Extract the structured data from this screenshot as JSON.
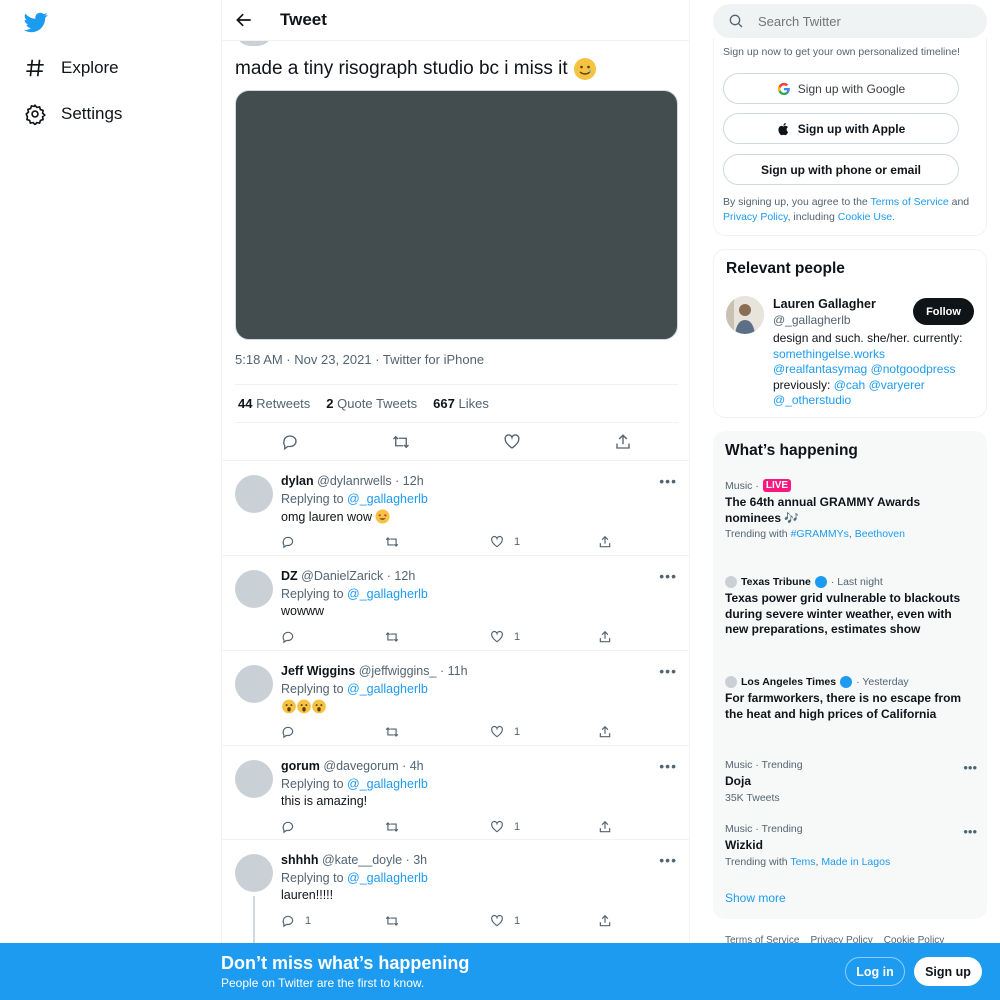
{
  "nav": {
    "items": [
      {
        "label": "Explore",
        "icon": "hashtag-icon"
      },
      {
        "label": "Settings",
        "icon": "gear-icon"
      }
    ]
  },
  "header": {
    "title": "Tweet"
  },
  "tweet": {
    "text": "made a tiny risograph studio bc i miss it",
    "emoji": "smiling-tear-emoji",
    "meta": "5:18 AM · Nov 23, 2021 · Twitter for iPhone",
    "retweets": {
      "count": "44",
      "label": "Retweets"
    },
    "quotes": {
      "count": "2",
      "label": "Quote Tweets"
    },
    "likes": {
      "count": "667",
      "label": "Likes"
    }
  },
  "replies": [
    {
      "name": "dylan",
      "handle": "@dylanrwells",
      "time": "· 12h",
      "replying": "Replying to",
      "to": "@_gallagherlb",
      "text": "omg lauren wow",
      "emoji": "heart-eyes-emoji",
      "reply_count": "",
      "like_count": "1"
    },
    {
      "name": "DZ",
      "handle": "@DanielZarick",
      "time": "· 12h",
      "replying": "Replying to",
      "to": "@_gallagherlb",
      "text": "wowww",
      "reply_count": "",
      "like_count": "1"
    },
    {
      "name": "Jeff Wiggins",
      "handle": "@jeffwiggins_",
      "time": "· 11h",
      "replying": "Replying to",
      "to": "@_gallagherlb",
      "text": "",
      "emoji": "astonished-face-emoji-x3",
      "reply_count": "",
      "like_count": "1"
    },
    {
      "name": "gorum",
      "handle": "@davegorum",
      "time": "· 4h",
      "replying": "Replying to",
      "to": "@_gallagherlb",
      "text": "this is amazing!",
      "reply_count": "",
      "like_count": "1"
    },
    {
      "name": "shhhh",
      "handle": "@kate__doyle",
      "time": "· 3h",
      "replying": "Replying to",
      "to": "@_gallagherlb",
      "text": "lauren!!!!!",
      "reply_count": "1",
      "like_count": "1"
    }
  ],
  "search": {
    "placeholder": "Search Twitter"
  },
  "signup": {
    "note": "Sign up now to get your own personalized timeline!",
    "google": "Sign up with Google",
    "apple": "Sign up with Apple",
    "phone": "Sign up with phone or email",
    "legal_pre": "By signing up, you agree to the ",
    "tos": "Terms of Service",
    "legal_and": " and ",
    "privacy": "Privacy Policy",
    "legal_mid": ", including ",
    "cookie": "Cookie Use."
  },
  "relevant": {
    "title": "Relevant people",
    "name": "Lauren Gallagher",
    "handle": "@_gallagherlb",
    "follow": "Follow",
    "bio1": "design and such. she/her. currently: ",
    "link1": "somethingelse.works",
    "link2": "@realfantasymag",
    "link3": "@notgoodpress",
    "bio2": " previously: ",
    "link4": "@cah",
    "link5": "@varyerer",
    "link6": "@_otherstudio"
  },
  "happening": {
    "title": "What’s happening",
    "trends": [
      {
        "category": "Music ·",
        "live": "LIVE",
        "title": "The 64th annual GRAMMY Awards nominees 🎶",
        "sub_pre": "Trending with ",
        "sub_link1": "#GRAMMYs",
        "sub_mid": ", ",
        "sub_link2": "Beethoven"
      },
      {
        "source": "Texas Tribune",
        "when": "· Last night",
        "title": "Texas power grid vulnerable to blackouts during severe winter weather, even with new preparations, estimates show"
      },
      {
        "source": "Los Angeles Times",
        "when": "· Yesterday",
        "title": "For farmworkers, there is no escape from the heat and high prices of California"
      },
      {
        "category": "Music · Trending",
        "title": "Doja",
        "sub": "35K Tweets"
      },
      {
        "category": "Music · Trending",
        "title": "Wizkid",
        "sub_pre": "Trending with ",
        "sub_link1": "Tems",
        "sub_mid": ", ",
        "sub_link2": "Made in Lagos"
      }
    ],
    "show_more": "Show more"
  },
  "footer": {
    "links": [
      "Terms of Service",
      "Privacy Policy",
      "Cookie Policy"
    ]
  },
  "banner": {
    "title": "Don’t miss what’s happening",
    "subtitle": "People on Twitter are the first to know.",
    "login": "Log in",
    "signup": "Sign up"
  },
  "colors": {
    "accent": "#1d9bf0",
    "live": "#f91880",
    "media": "#434d4f"
  }
}
